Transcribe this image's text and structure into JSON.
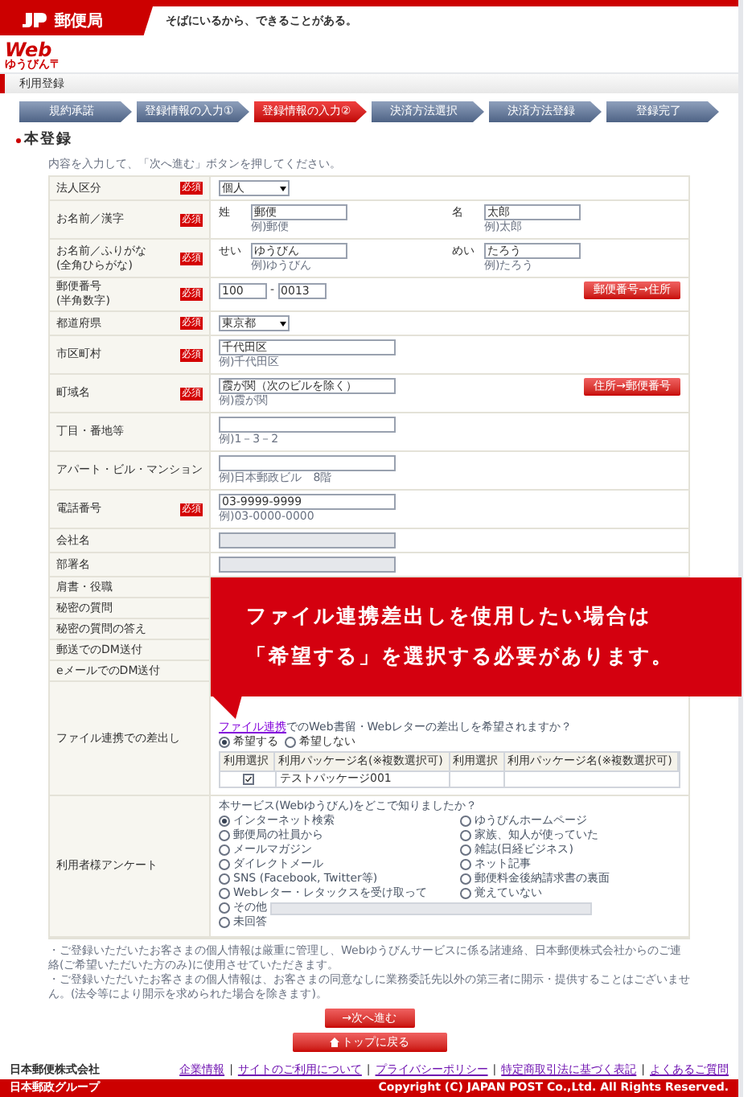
{
  "header": {
    "logo_text": "郵便局",
    "tagline": "そばにいるから、できることがある。"
  },
  "brand": {
    "title": "Web",
    "subtitle": "ゆうびん〒"
  },
  "section_title": "利用登録",
  "steps": [
    {
      "label": "規約承諾",
      "selected": false
    },
    {
      "label": "登録情報の入力①",
      "selected": false
    },
    {
      "label": "登録情報の入力②",
      "selected": true
    },
    {
      "label": "決済方法選択",
      "selected": false
    },
    {
      "label": "決済方法登録",
      "selected": false
    },
    {
      "label": "登録完了",
      "selected": false
    }
  ],
  "heading": "本登録",
  "instruction": "内容を入力して、「次へ進む」ボタンを押してください。",
  "rows": [
    {
      "label": "法人区分",
      "badge": "必須",
      "kind": "select",
      "value": "個人"
    },
    {
      "label": "お名前／漢字",
      "badge": "必須",
      "kind": "name",
      "fields": [
        {
          "prefix": "姓",
          "value": "郵便",
          "example": "例)郵便"
        },
        {
          "prefix": "名",
          "value": "太郎",
          "example": "例)太郎"
        }
      ]
    },
    {
      "label": "お名前／ふりがな",
      "sublabel": "(全角ひらがな)",
      "badge": "必須",
      "kind": "name",
      "fields": [
        {
          "prefix": "せい",
          "value": "ゆうびん",
          "example": "例)ゆうびん"
        },
        {
          "prefix": "めい",
          "value": "たろう",
          "example": "例)たろう"
        }
      ]
    },
    {
      "label": "郵便番号",
      "sublabel": "(半角数字)",
      "badge": "必須",
      "kind": "postal",
      "parts": [
        "100",
        "0013"
      ],
      "separator": "-",
      "button": "郵便番号→住所"
    },
    {
      "label": "都道府県",
      "badge": "必須",
      "kind": "select",
      "value": "東京都"
    },
    {
      "label": "市区町村",
      "badge": "必須",
      "kind": "text",
      "value": "千代田区",
      "example": "例)千代田区"
    },
    {
      "label": "町域名",
      "badge": "必須",
      "kind": "text",
      "value": "霞が関（次のビルを除く）",
      "example": "例)霞が関",
      "button": "住所→郵便番号"
    },
    {
      "label": "丁目・番地等",
      "kind": "text",
      "example": "例)1－3－2"
    },
    {
      "label": "アパート・ビル・マンション",
      "kind": "text",
      "example": "例)日本郵政ビル　8階"
    },
    {
      "label": "電話番号",
      "badge": "必須",
      "kind": "text",
      "value": "03-9999-9999",
      "example": "例)03-0000-0000"
    },
    {
      "label": "会社名",
      "kind": "text",
      "disabled": true
    },
    {
      "label": "部署名",
      "kind": "text",
      "disabled": true
    },
    {
      "label": "肩書・役職",
      "kind": "hidden"
    },
    {
      "label": "秘密の質問",
      "kind": "hidden"
    },
    {
      "label": "秘密の質問の答え",
      "kind": "hidden"
    },
    {
      "label": "郵送でのDM送付",
      "kind": "hidden"
    },
    {
      "label": "eメールでのDM送付",
      "kind": "hidden"
    },
    {
      "label": "ファイル連携での差出し",
      "kind": "file",
      "link": "ファイル連携",
      "question": "でのWeb書留・Webレターの差出しを希望されますか？",
      "options": [
        {
          "label": "希望する",
          "selected": true
        },
        {
          "label": "希望しない",
          "selected": false
        }
      ],
      "columns": [
        "利用選択",
        "利用パッケージ名(※複数選択可)",
        "利用選択",
        "利用パッケージ名(※複数選択可)"
      ],
      "packages": [
        {
          "checked": true,
          "name": "テストパッケージ001"
        }
      ]
    },
    {
      "label": "利用者様アンケート",
      "kind": "survey",
      "question": "本サービス(Webゆうびん)をどこで知りましたか？",
      "options": [
        {
          "label": "インターネット検索",
          "selected": true
        },
        {
          "label": "ゆうびんホームページ",
          "selected": false
        },
        {
          "label": "郵便局の社員から",
          "selected": false
        },
        {
          "label": "家族、知人が使っていた",
          "selected": false
        },
        {
          "label": "メールマガジン",
          "selected": false
        },
        {
          "label": "雑誌(日経ビジネス)",
          "selected": false
        },
        {
          "label": "ダイレクトメール",
          "selected": false
        },
        {
          "label": "ネット記事",
          "selected": false
        },
        {
          "label": "SNS (Facebook, Twitter等)",
          "selected": false
        },
        {
          "label": "郵便料金後納請求書の裏面",
          "selected": false
        },
        {
          "label": "Webレター・レタックスを受け取って",
          "selected": false
        },
        {
          "label": "覚えていない",
          "selected": false
        },
        {
          "label": "その他",
          "selected": false,
          "kind": "other"
        },
        {
          "label": "未回答",
          "selected": false,
          "kind": "wide"
        }
      ]
    }
  ],
  "notes": [
    "・ご登録いただいたお客さまの個人情報は厳重に管理し、Webゆうびんサービスに係る諸連絡、日本郵便株式会社からのご連絡(ご希望いただいた方のみ)に使用させていただきます。",
    "・ご登録いただいたお客さまの個人情報は、お客さまの同意なしに業務委託先以外の第三者に開示・提供することはございません。(法令等により開示を求められた場合を除きます)。"
  ],
  "buttons": [
    {
      "label": "→次へ進む",
      "kind": "next"
    },
    {
      "label": "トップに戻る",
      "kind": "home"
    }
  ],
  "callout": {
    "lines": [
      "ファイル連携差出しを使用したい場合は",
      "「希望する」を選択する必要があります。"
    ]
  },
  "footer": {
    "company": "日本郵便株式会社",
    "links": [
      "企業情報",
      "サイトのご利用について",
      "プライバシーポリシー",
      "特定商取引法に基づく表記",
      "よくあるご質問"
    ],
    "separator": "|",
    "group": "日本郵政グループ",
    "copyright": "Copyright (C) JAPAN POST Co.,Ltd. All Rights Reserved."
  }
}
